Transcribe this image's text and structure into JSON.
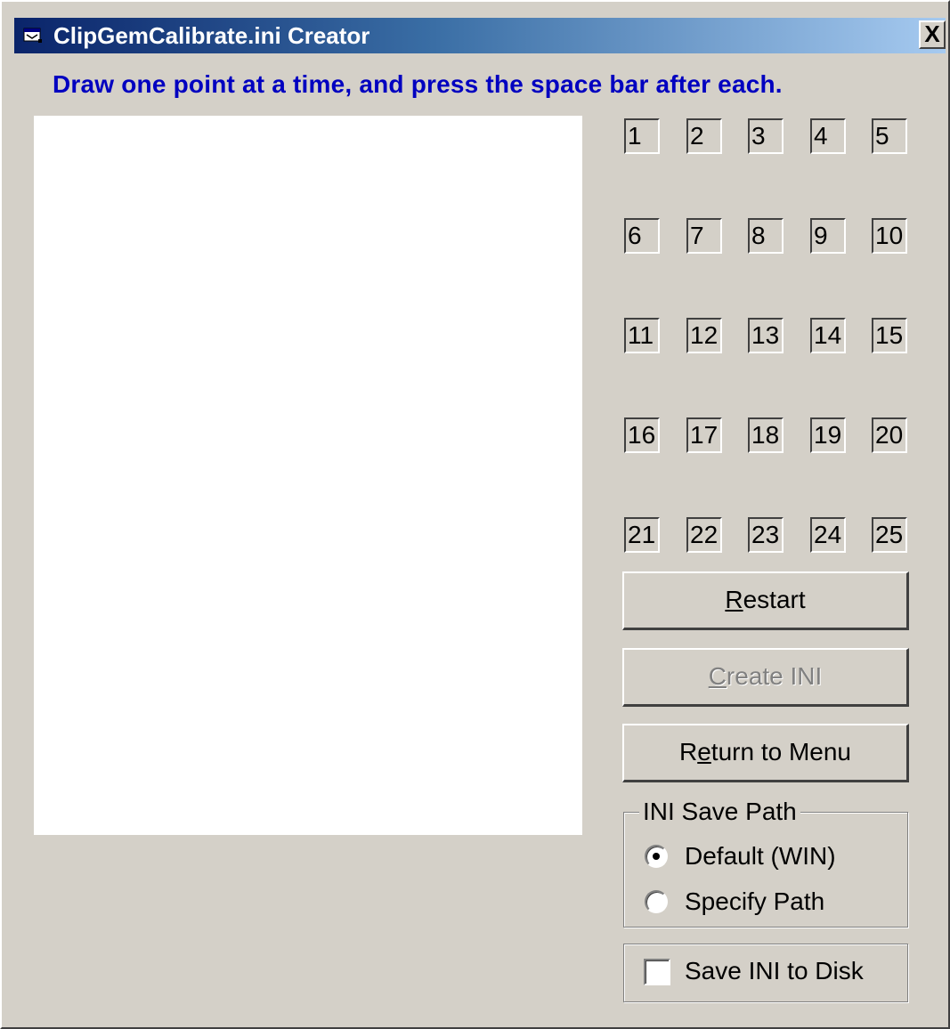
{
  "window": {
    "title": "ClipGemCalibrate.ini Creator",
    "close_glyph": "✕",
    "close_label": "X"
  },
  "instruction": "Draw one point at a time, and press the space bar after each.",
  "points": [
    "1",
    "2",
    "3",
    "4",
    "5",
    "6",
    "7",
    "8",
    "9",
    "10",
    "11",
    "12",
    "13",
    "14",
    "15",
    "16",
    "17",
    "18",
    "19",
    "20",
    "21",
    "22",
    "23",
    "24",
    "25"
  ],
  "buttons": {
    "restart": {
      "mnemonic": "R",
      "rest": "estart"
    },
    "create_ini": {
      "mnemonic": "C",
      "rest": "reate INI",
      "enabled": false
    },
    "return_menu": {
      "before": "R",
      "mnemonic": "e",
      "rest": "turn to Menu"
    }
  },
  "ini_save_path": {
    "legend": "INI Save Path",
    "options": [
      {
        "label": "Default (WIN)",
        "selected": true
      },
      {
        "label": "Specify Path",
        "selected": false
      }
    ]
  },
  "save_to_disk": {
    "label": "Save INI to Disk",
    "checked": false
  },
  "colors": {
    "face": "#d4d0c8",
    "instruction_text": "#0000c0",
    "title_gradient_start": "#0a246a",
    "title_gradient_end": "#a6caf0"
  },
  "icons": {
    "title": "app-window-icon",
    "close": "close-icon"
  }
}
